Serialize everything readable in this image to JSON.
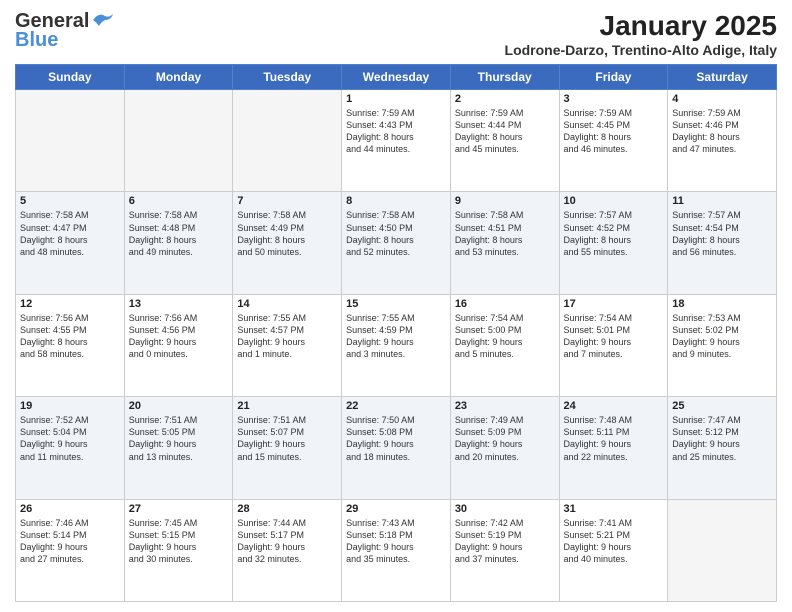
{
  "header": {
    "logo_line1": "General",
    "logo_line2": "Blue",
    "month": "January 2025",
    "location": "Lodrone-Darzo, Trentino-Alto Adige, Italy"
  },
  "days_of_week": [
    "Sunday",
    "Monday",
    "Tuesday",
    "Wednesday",
    "Thursday",
    "Friday",
    "Saturday"
  ],
  "weeks": [
    [
      {
        "day": "",
        "text": ""
      },
      {
        "day": "",
        "text": ""
      },
      {
        "day": "",
        "text": ""
      },
      {
        "day": "1",
        "text": "Sunrise: 7:59 AM\nSunset: 4:43 PM\nDaylight: 8 hours\nand 44 minutes."
      },
      {
        "day": "2",
        "text": "Sunrise: 7:59 AM\nSunset: 4:44 PM\nDaylight: 8 hours\nand 45 minutes."
      },
      {
        "day": "3",
        "text": "Sunrise: 7:59 AM\nSunset: 4:45 PM\nDaylight: 8 hours\nand 46 minutes."
      },
      {
        "day": "4",
        "text": "Sunrise: 7:59 AM\nSunset: 4:46 PM\nDaylight: 8 hours\nand 47 minutes."
      }
    ],
    [
      {
        "day": "5",
        "text": "Sunrise: 7:58 AM\nSunset: 4:47 PM\nDaylight: 8 hours\nand 48 minutes."
      },
      {
        "day": "6",
        "text": "Sunrise: 7:58 AM\nSunset: 4:48 PM\nDaylight: 8 hours\nand 49 minutes."
      },
      {
        "day": "7",
        "text": "Sunrise: 7:58 AM\nSunset: 4:49 PM\nDaylight: 8 hours\nand 50 minutes."
      },
      {
        "day": "8",
        "text": "Sunrise: 7:58 AM\nSunset: 4:50 PM\nDaylight: 8 hours\nand 52 minutes."
      },
      {
        "day": "9",
        "text": "Sunrise: 7:58 AM\nSunset: 4:51 PM\nDaylight: 8 hours\nand 53 minutes."
      },
      {
        "day": "10",
        "text": "Sunrise: 7:57 AM\nSunset: 4:52 PM\nDaylight: 8 hours\nand 55 minutes."
      },
      {
        "day": "11",
        "text": "Sunrise: 7:57 AM\nSunset: 4:54 PM\nDaylight: 8 hours\nand 56 minutes."
      }
    ],
    [
      {
        "day": "12",
        "text": "Sunrise: 7:56 AM\nSunset: 4:55 PM\nDaylight: 8 hours\nand 58 minutes."
      },
      {
        "day": "13",
        "text": "Sunrise: 7:56 AM\nSunset: 4:56 PM\nDaylight: 9 hours\nand 0 minutes."
      },
      {
        "day": "14",
        "text": "Sunrise: 7:55 AM\nSunset: 4:57 PM\nDaylight: 9 hours\nand 1 minute."
      },
      {
        "day": "15",
        "text": "Sunrise: 7:55 AM\nSunset: 4:59 PM\nDaylight: 9 hours\nand 3 minutes."
      },
      {
        "day": "16",
        "text": "Sunrise: 7:54 AM\nSunset: 5:00 PM\nDaylight: 9 hours\nand 5 minutes."
      },
      {
        "day": "17",
        "text": "Sunrise: 7:54 AM\nSunset: 5:01 PM\nDaylight: 9 hours\nand 7 minutes."
      },
      {
        "day": "18",
        "text": "Sunrise: 7:53 AM\nSunset: 5:02 PM\nDaylight: 9 hours\nand 9 minutes."
      }
    ],
    [
      {
        "day": "19",
        "text": "Sunrise: 7:52 AM\nSunset: 5:04 PM\nDaylight: 9 hours\nand 11 minutes."
      },
      {
        "day": "20",
        "text": "Sunrise: 7:51 AM\nSunset: 5:05 PM\nDaylight: 9 hours\nand 13 minutes."
      },
      {
        "day": "21",
        "text": "Sunrise: 7:51 AM\nSunset: 5:07 PM\nDaylight: 9 hours\nand 15 minutes."
      },
      {
        "day": "22",
        "text": "Sunrise: 7:50 AM\nSunset: 5:08 PM\nDaylight: 9 hours\nand 18 minutes."
      },
      {
        "day": "23",
        "text": "Sunrise: 7:49 AM\nSunset: 5:09 PM\nDaylight: 9 hours\nand 20 minutes."
      },
      {
        "day": "24",
        "text": "Sunrise: 7:48 AM\nSunset: 5:11 PM\nDaylight: 9 hours\nand 22 minutes."
      },
      {
        "day": "25",
        "text": "Sunrise: 7:47 AM\nSunset: 5:12 PM\nDaylight: 9 hours\nand 25 minutes."
      }
    ],
    [
      {
        "day": "26",
        "text": "Sunrise: 7:46 AM\nSunset: 5:14 PM\nDaylight: 9 hours\nand 27 minutes."
      },
      {
        "day": "27",
        "text": "Sunrise: 7:45 AM\nSunset: 5:15 PM\nDaylight: 9 hours\nand 30 minutes."
      },
      {
        "day": "28",
        "text": "Sunrise: 7:44 AM\nSunset: 5:17 PM\nDaylight: 9 hours\nand 32 minutes."
      },
      {
        "day": "29",
        "text": "Sunrise: 7:43 AM\nSunset: 5:18 PM\nDaylight: 9 hours\nand 35 minutes."
      },
      {
        "day": "30",
        "text": "Sunrise: 7:42 AM\nSunset: 5:19 PM\nDaylight: 9 hours\nand 37 minutes."
      },
      {
        "day": "31",
        "text": "Sunrise: 7:41 AM\nSunset: 5:21 PM\nDaylight: 9 hours\nand 40 minutes."
      },
      {
        "day": "",
        "text": ""
      }
    ]
  ]
}
